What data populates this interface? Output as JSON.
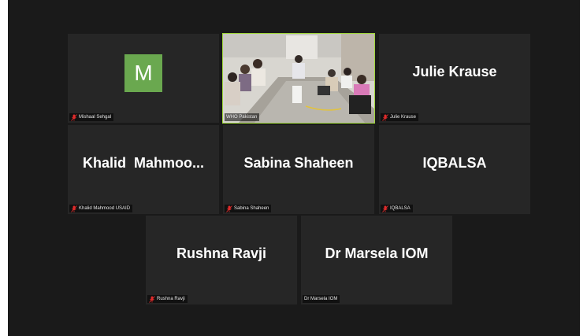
{
  "participants": [
    {
      "id": "mishaal",
      "display_name": "",
      "avatar_initial": "M",
      "label": "Mishaal Sehgal",
      "muted": true
    },
    {
      "id": "who",
      "display_name": "",
      "label": "WHO Pakistan",
      "muted": false,
      "active_speaker": true
    },
    {
      "id": "julie",
      "display_name": "Julie Krause",
      "label": "Julie Krause",
      "muted": true
    },
    {
      "id": "khalid",
      "display_name": "Khalid  Mahmoo...",
      "label": "Khalid Mahmood USAID",
      "muted": true
    },
    {
      "id": "sabina",
      "display_name": "Sabina Shaheen",
      "label": "Sabina Shaheen",
      "muted": true
    },
    {
      "id": "iqbalsa",
      "display_name": "IQBALSA",
      "label": "IQBALSA",
      "muted": true
    },
    {
      "id": "rushna",
      "display_name": "Rushna Ravji",
      "label": "Rushna Ravji",
      "muted": true
    },
    {
      "id": "marsela",
      "display_name": "Dr Marsela IOM",
      "label": "Dr Marsela IOM",
      "muted": false
    }
  ],
  "colors": {
    "active_border": "#9fd73a",
    "avatar_bg": "#6aa84f",
    "mute_red": "#e02b2b",
    "tile_bg": "#262626"
  }
}
